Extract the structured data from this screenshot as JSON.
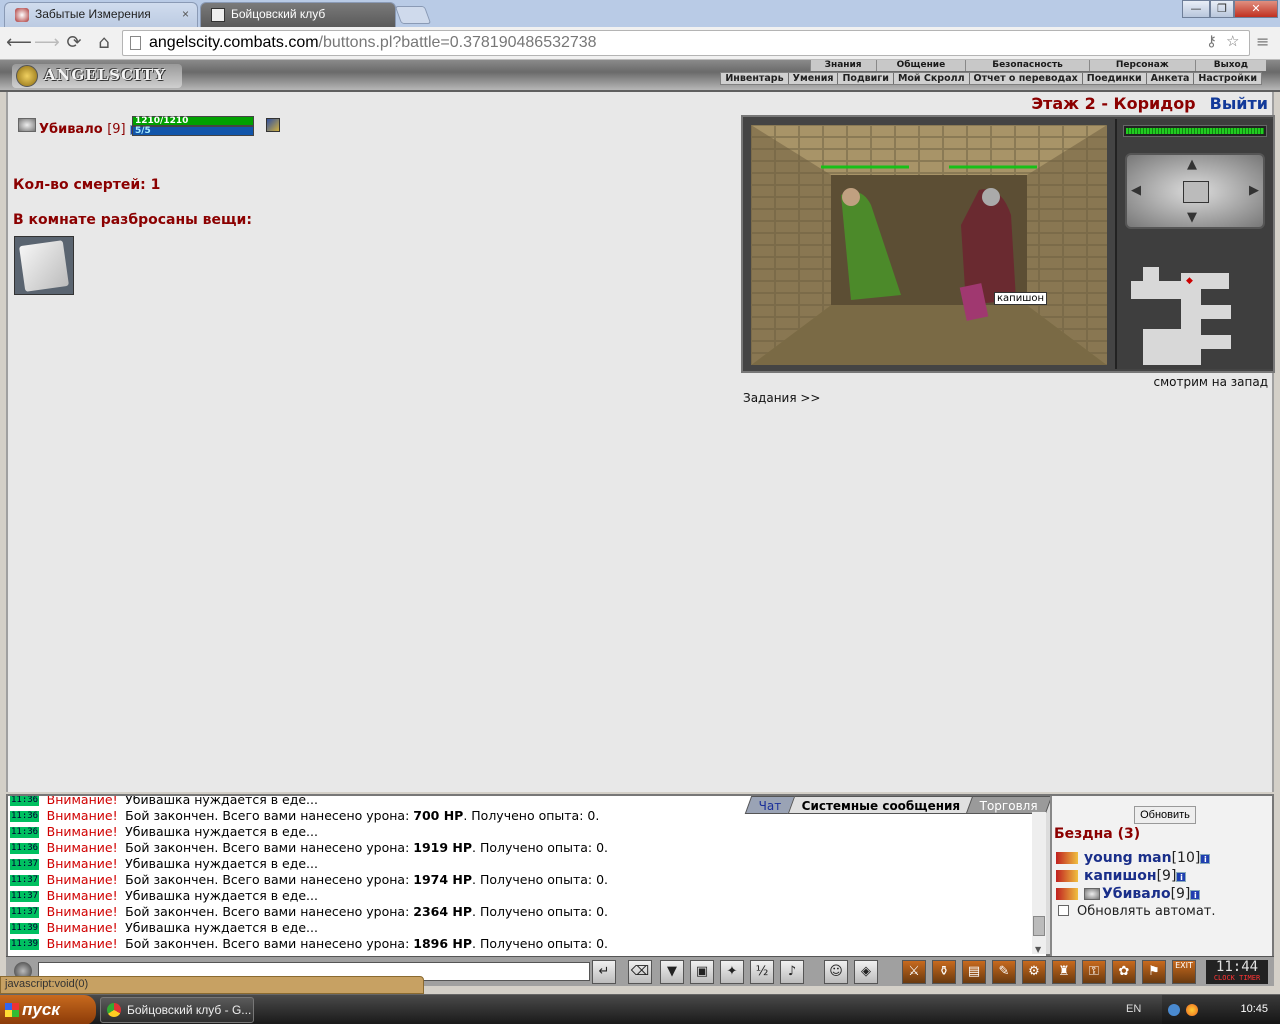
{
  "browser": {
    "tabs": [
      {
        "label": "Забытые Измерения",
        "close": "×"
      },
      {
        "label": "Бойцовский клуб",
        "close": ""
      }
    ],
    "url_host": "angelscity.combats.com",
    "url_path": "/buttons.pl?battle=0.378190486532738",
    "window_buttons": [
      "—",
      "❐",
      "✕"
    ]
  },
  "game_header": {
    "logo": "ANGELSCITY",
    "menu_top": [
      "Знания",
      "Общение",
      "Безопасность",
      "Персонаж",
      "Выход"
    ],
    "menu_bottom": [
      "Инвентарь",
      "Умения",
      "Подвиги",
      "Мой Скролл",
      "Отчет о переводах",
      "Поединки",
      "Анкета",
      "Настройки"
    ]
  },
  "character": {
    "name": "Убивало",
    "level": "[9]",
    "hp": "1210/1210",
    "mp": "5/5",
    "hp_fraction": 1.0,
    "mp_fraction": 1.0
  },
  "deaths_text": "Кол-во смертей: 1",
  "items_title": "В комнате разбросаны вещи:",
  "location": {
    "name": "Этаж 2 - Коридор",
    "exit": "Выйти",
    "facing": "смотрим на запад",
    "tasks": "Задания >>",
    "npc_label": "капишон"
  },
  "chat": {
    "tabs": [
      "Чат",
      "Системные сообщения",
      "Торговля"
    ],
    "lines": [
      {
        "time": "11:36",
        "warn": "Внимание!",
        "text": "Убивашка нуждается в еде...",
        "hp": "",
        "tail": ""
      },
      {
        "time": "11:36",
        "warn": "Внимание!",
        "text": "Бой закончен. Всего вами нанесено урона: ",
        "hp": "700 HP",
        "tail": ". Получено опыта: 0."
      },
      {
        "time": "11:36",
        "warn": "Внимание!",
        "text": "Убивашка нуждается в еде...",
        "hp": "",
        "tail": ""
      },
      {
        "time": "11:36",
        "warn": "Внимание!",
        "text": "Бой закончен. Всего вами нанесено урона: ",
        "hp": "1919 HP",
        "tail": ". Получено опыта: 0."
      },
      {
        "time": "11:37",
        "warn": "Внимание!",
        "text": "Убивашка нуждается в еде...",
        "hp": "",
        "tail": ""
      },
      {
        "time": "11:37",
        "warn": "Внимание!",
        "text": "Бой закончен. Всего вами нанесено урона: ",
        "hp": "1974 HP",
        "tail": ". Получено опыта: 0."
      },
      {
        "time": "11:37",
        "warn": "Внимание!",
        "text": "Убивашка нуждается в еде...",
        "hp": "",
        "tail": ""
      },
      {
        "time": "11:37",
        "warn": "Внимание!",
        "text": "Бой закончен. Всего вами нанесено урона: ",
        "hp": "2364 HP",
        "tail": ". Получено опыта: 0."
      },
      {
        "time": "11:39",
        "warn": "Внимание!",
        "text": "Убивашка нуждается в еде...",
        "hp": "",
        "tail": ""
      },
      {
        "time": "11:39",
        "warn": "Внимание!",
        "text": "Бой закончен. Всего вами нанесено урона: ",
        "hp": "1896 HP",
        "tail": ". Получено опыта: 0."
      }
    ]
  },
  "room_panel": {
    "refresh": "Обновить",
    "title": "Бездна (3)",
    "users": [
      {
        "name": "young man",
        "level": "[10]"
      },
      {
        "name": "капишон",
        "level": "[9]"
      },
      {
        "name": "Убивало",
        "level": "[9]"
      }
    ],
    "auto_refresh": "Обновлять автомат."
  },
  "bottom": {
    "clock": "11:44",
    "clock_sub": "CLOCK TIMER",
    "exit_label": "EXIT",
    "status": "javascript:void(0)"
  },
  "taskbar": {
    "start": "пуск",
    "item": "Бойцовский клуб - G...",
    "lang": "EN",
    "time": "10:45"
  }
}
